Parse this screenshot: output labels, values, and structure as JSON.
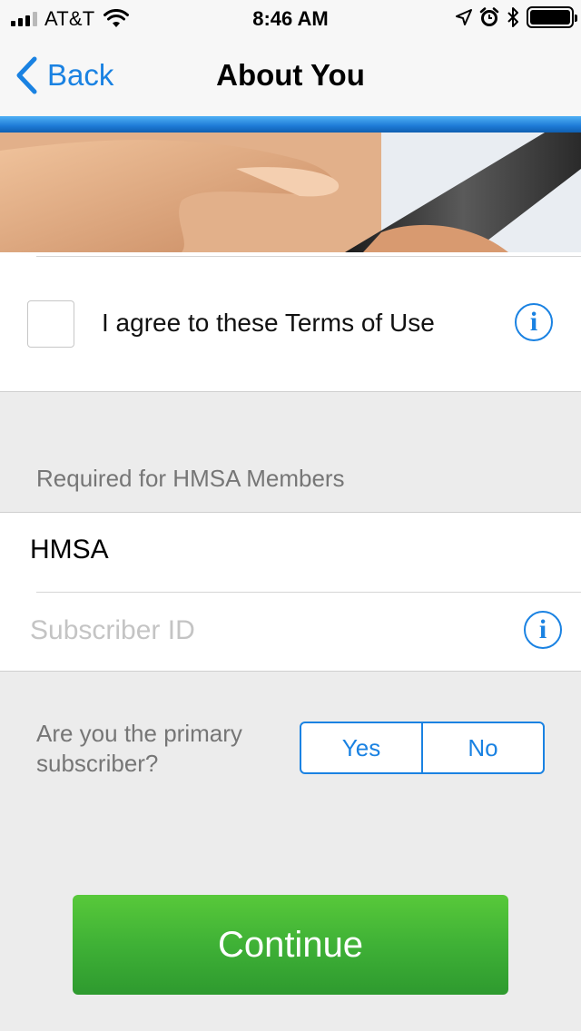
{
  "status_bar": {
    "carrier": "AT&T",
    "time": "8:46 AM",
    "icons": [
      "signal-icon",
      "wifi-icon",
      "location-icon",
      "alarm-icon",
      "bluetooth-icon",
      "battery-icon"
    ]
  },
  "nav": {
    "back_label": "Back",
    "title": "About You"
  },
  "banner": {
    "image": "hand-holding-phone-photo"
  },
  "terms": {
    "checked": false,
    "label": "I agree to these Terms of Use",
    "info_glyph": "i"
  },
  "hmsa_section": {
    "header": "Required for HMSA Members",
    "plan_value": "HMSA",
    "subscriber_placeholder": "Subscriber ID",
    "subscriber_value": "",
    "info_glyph": "i"
  },
  "primary_subscriber": {
    "question": "Are you the primary subscriber?",
    "options": [
      "Yes",
      "No"
    ]
  },
  "actions": {
    "continue_label": "Continue"
  },
  "colors": {
    "accent": "#1a82e2",
    "continue_green": "#3fb136",
    "background": "#ececec"
  }
}
